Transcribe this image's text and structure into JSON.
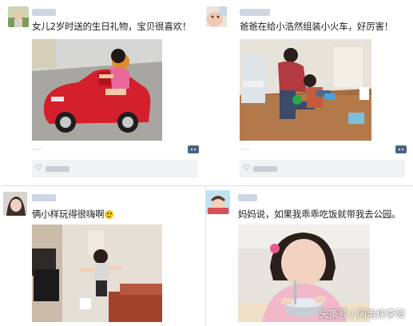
{
  "posts": [
    {
      "username": "·····",
      "caption": "女儿2岁时送的生日礼物，宝贝很喜欢！",
      "photo": "child-in-red-toy-car",
      "timestamp": "·····",
      "likes": "·····",
      "icons": {
        "comment": "comment-icon",
        "like": "heart-icon"
      }
    },
    {
      "username": "·····",
      "caption": "爸爸在给小浩然组装小火车，好厉害！",
      "photo": "father-and-son-assembling-toy-train",
      "timestamp": "·····",
      "likes": "·····",
      "icons": {
        "comment": "comment-icon",
        "like": "heart-icon"
      }
    },
    {
      "username": "·····",
      "caption": "俩小样玩得很嗨啊",
      "emoji": "smile-emoji",
      "photo": "two-children-dancing-in-room"
    },
    {
      "username": "·····",
      "caption": "妈妈说，如果我乖乖吃饭就带我去公园。",
      "photo": "little-girl-eating-from-bowl"
    }
  ],
  "watermark": "头条号 / 闪电侠李哥",
  "colors": {
    "caption": "#1c1c1c",
    "timestamp": "#9aa0a8",
    "accent": "#4a6487",
    "like_bar": "#f1f2f4"
  }
}
